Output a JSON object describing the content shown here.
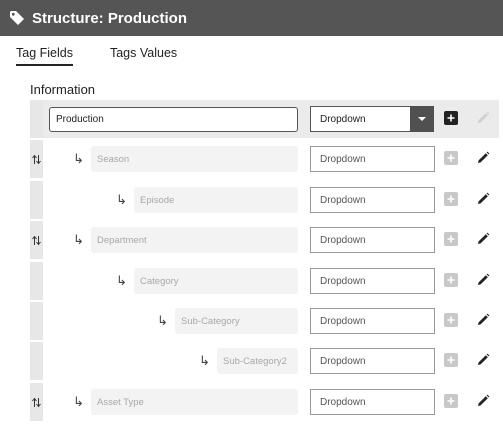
{
  "header": {
    "title": "Structure: Production"
  },
  "tabs": [
    {
      "label": "Tag Fields",
      "active": true
    },
    {
      "label": "Tags Values",
      "active": false
    }
  ],
  "section": {
    "label": "Information"
  },
  "root": {
    "name": "Production",
    "type": "Dropdown"
  },
  "fields": [
    {
      "name": "Season",
      "type": "Dropdown",
      "level": 1,
      "movable": true
    },
    {
      "name": "Episode",
      "type": "Dropdown",
      "level": 2,
      "movable": false
    },
    {
      "name": "Department",
      "type": "Dropdown",
      "level": 1,
      "movable": true
    },
    {
      "name": "Category",
      "type": "Dropdown",
      "level": 2,
      "movable": false
    },
    {
      "name": "Sub-Category",
      "type": "Dropdown",
      "level": 3,
      "movable": false
    },
    {
      "name": "Sub-Category2",
      "type": "Dropdown",
      "level": 4,
      "movable": false
    },
    {
      "name": "Asset Type",
      "type": "Dropdown",
      "level": 1,
      "movable": true
    }
  ],
  "colors": {
    "header_bg": "#555555",
    "accent": "#222222",
    "disabled": "#c8c8c8"
  }
}
